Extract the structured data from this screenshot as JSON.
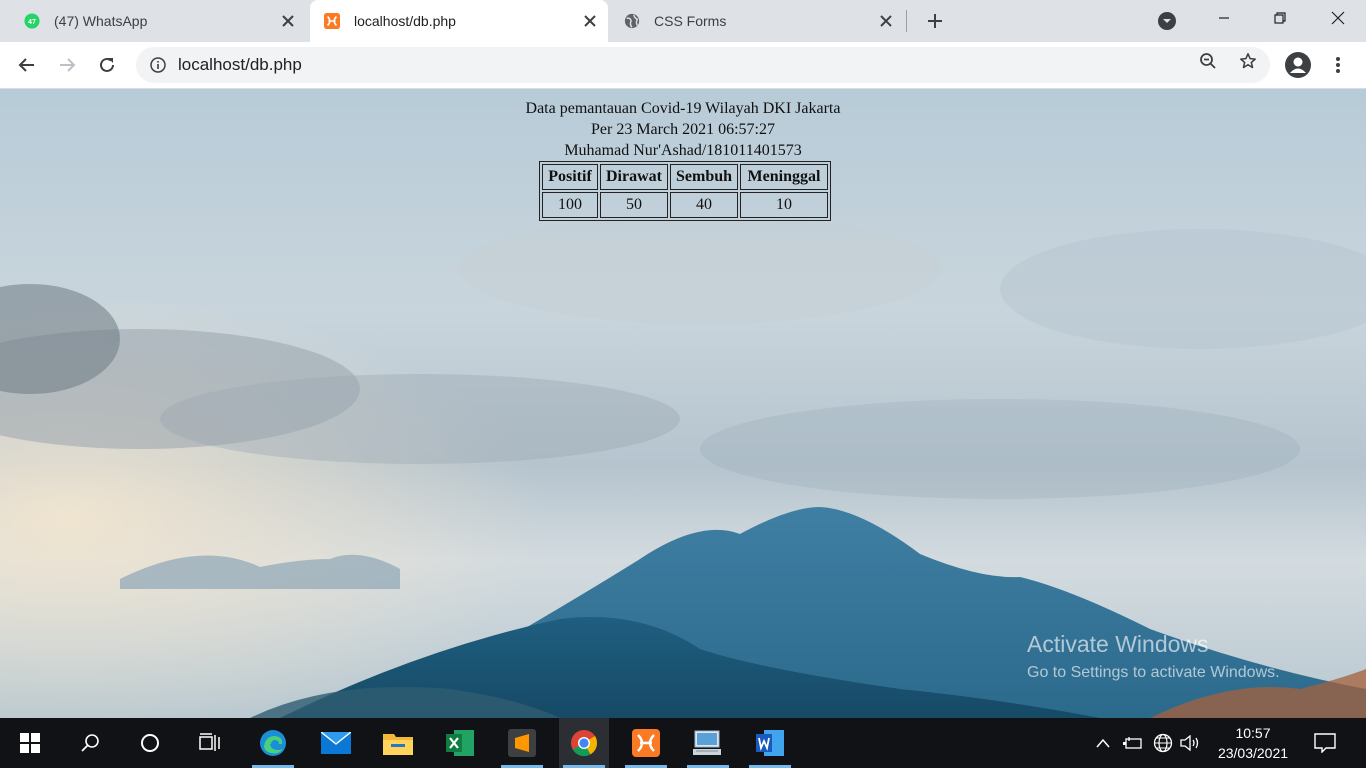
{
  "browser": {
    "tabs": [
      {
        "title": "(47) WhatsApp",
        "badge": "47",
        "icon": "whatsapp-icon"
      },
      {
        "title": "localhost/db.php",
        "icon": "xampp-icon"
      },
      {
        "title": "CSS Forms",
        "icon": "globe-icon"
      }
    ],
    "address": "localhost/db.php"
  },
  "page": {
    "heading": "Data pemantauan Covid-19 Wilayah DKI Jakarta",
    "timestamp": "Per 23 March 2021 06:57:27",
    "author": "Muhamad Nur'Ashad/181011401573",
    "table": {
      "headers": [
        "Positif",
        "Dirawat",
        "Sembuh",
        "Meninggal"
      ],
      "row": [
        "100",
        "50",
        "40",
        "10"
      ]
    }
  },
  "watermark": {
    "line1": "Activate Windows",
    "line2": "Go to Settings to activate Windows."
  },
  "taskbar": {
    "time": "10:57",
    "date": "23/03/2021"
  },
  "colors": {
    "accent": "#76b9ed",
    "taskbar_bg": "#101216",
    "tabstrip_bg": "#dee1e6"
  }
}
